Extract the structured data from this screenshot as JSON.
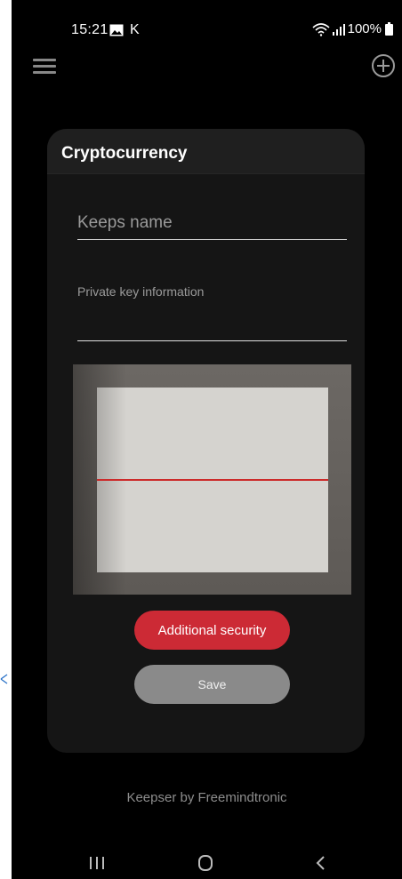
{
  "status_bar": {
    "time": "15:21",
    "carrier_letter": "K",
    "battery": "100%",
    "icons": [
      "gallery-icon",
      "wifi-icon",
      "signal-icon",
      "battery-icon"
    ]
  },
  "appbar": {
    "menu_icon": "hamburger-menu-icon",
    "add_icon": "circle-plus-icon"
  },
  "dialog": {
    "title": "Cryptocurrency",
    "keeps_name_placeholder": "Keeps name",
    "private_key_label": "Private key information",
    "private_key_value": "",
    "additional_security_label": "Additional security",
    "save_label": "Save"
  },
  "footer": {
    "text": "Keepser by Freemindtronic"
  },
  "navbar": {
    "recents_icon": "recents-icon",
    "home_icon": "home-icon",
    "back_icon": "back-icon"
  },
  "colors": {
    "background": "#000000",
    "card": "#151515",
    "accent": "#cc2a35",
    "save_button": "#8a8a8a",
    "scan_line": "#cc2b2b"
  }
}
